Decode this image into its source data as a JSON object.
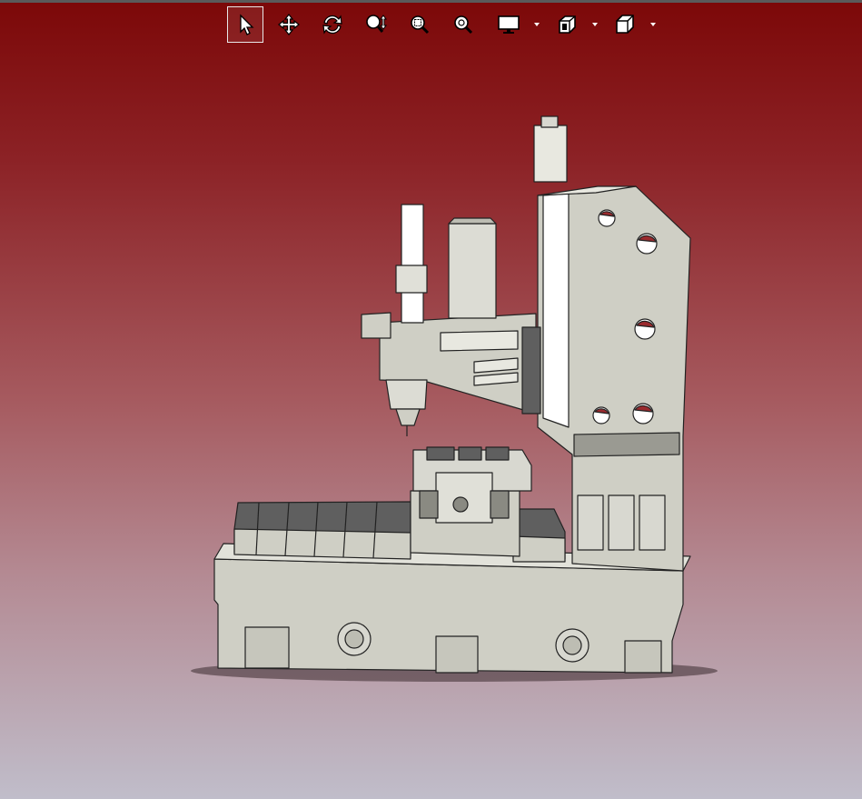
{
  "toolbar": {
    "buttons": [
      {
        "name": "select",
        "icon": "cursor-arrow-icon",
        "active": true
      },
      {
        "name": "pan",
        "icon": "move-arrows-icon",
        "active": false
      },
      {
        "name": "rotate",
        "icon": "rotate-arrows-icon",
        "active": false
      },
      {
        "name": "zoom",
        "icon": "zoom-updown-icon",
        "active": false
      },
      {
        "name": "zoom-window",
        "icon": "zoom-window-icon",
        "active": false
      },
      {
        "name": "zoom-fit",
        "icon": "zoom-fit-icon",
        "active": false
      },
      {
        "name": "display",
        "icon": "monitor-icon",
        "has_dropdown": true
      },
      {
        "name": "section",
        "icon": "section-cube-icon",
        "has_dropdown": true
      },
      {
        "name": "view",
        "icon": "view-cube-icon",
        "has_dropdown": true
      }
    ]
  },
  "viewport": {
    "model": "vertical-machining-center",
    "background_top": "#7c0808",
    "background_bottom": "#c0bdca",
    "model_fill": "#cfcfc5",
    "model_dark": "#5f5f5f",
    "hole_color": "#9a2a2e"
  }
}
